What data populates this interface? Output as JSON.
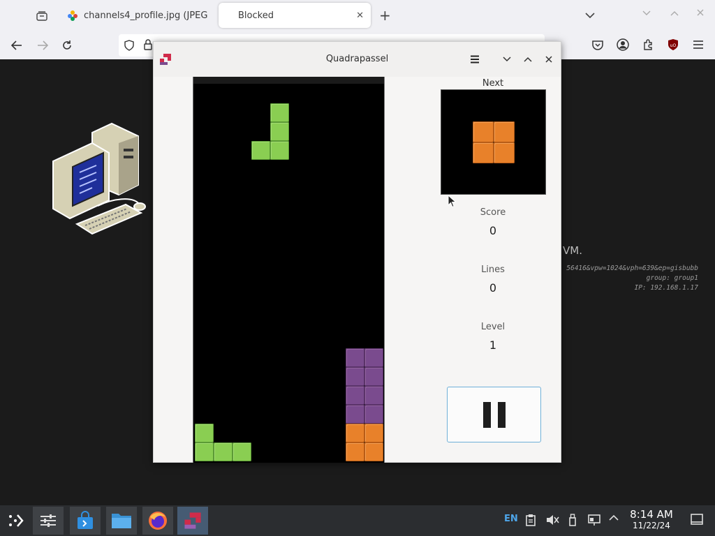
{
  "browser": {
    "tabs": [
      {
        "title": "channels4_profile.jpg (JPEG",
        "icon": "image-icon"
      },
      {
        "title": "Blocked",
        "icon": "none"
      }
    ],
    "new_tab_symbol": "+",
    "tab_close_symbol": "✕"
  },
  "desktop": {
    "vm_text": "VM.",
    "info_line1": "56416&vpw=1024&vph=639&ep=gisbubb",
    "info_group_label": "group: ",
    "info_group": "group1",
    "info_ip_label": "IP: ",
    "info_ip": "192.168.1.17"
  },
  "app": {
    "title": "Quadrapassel",
    "next_label": "Next",
    "score_label": "Score",
    "score": "0",
    "lines_label": "Lines",
    "lines": "0",
    "level_label": "Level",
    "level": "1"
  },
  "colors": {
    "green_piece": "#8ace52",
    "orange_piece": "#e8812a",
    "purple_piece": "#7a4b8e",
    "board_bg": "#000000",
    "pause_border": "#6fb0d8"
  },
  "taskbar": {
    "lang": "EN",
    "time": "8:14 AM",
    "date": "11/22/24",
    "apps": [
      "application-launcher-icon",
      "system-settings-icon",
      "software-store-icon",
      "file-manager-icon",
      "firefox-icon",
      "quadrapassel-icon"
    ]
  }
}
